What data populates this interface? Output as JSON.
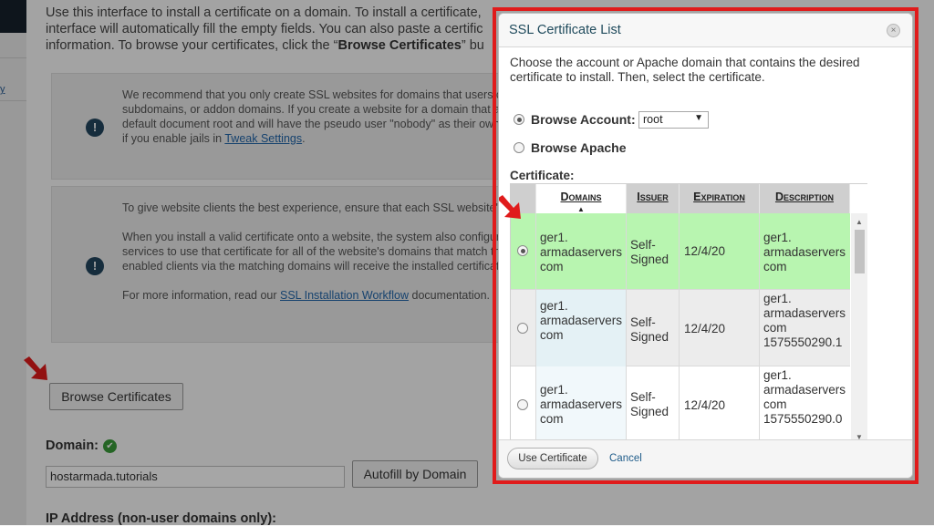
{
  "page": {
    "intro_lines": [
      "Use this interface to install a certificate on a domain. To install a certificate,",
      "interface will automatically fill the empty fields. You can also paste a certific",
      "information. To browse your certificates, click the “"
    ],
    "intro_bold": "Browse Certificates",
    "intro_tail": "” bu",
    "note1": {
      "lines": [
        "We recommend that you only create SSL websites for domains that users c",
        "subdomains, or addon domains. If you create a website for a domain that a",
        "default document root and will have the pseudo user \"nobody\" as their owne",
        "if you enable jails in "
      ],
      "link": "Tweak Settings",
      "link_tail": "."
    },
    "note2": {
      "p1": "To give website clients the best experience, ensure that each SSL website's",
      "p2_lines": [
        "When you install a valid certificate onto a website, the system also configur",
        "services to use that certificate for all of the website's domains that match th",
        "enabled clients via the matching domains will receive the installed certificat"
      ],
      "p3_pre": "For more information, read our ",
      "p3_link": "SSL Installation Workflow",
      "p3_post": " documentation."
    },
    "browse_button": "Browse Certificates",
    "domain_label": "Domain:",
    "domain_value": "hostarmada.tutorials",
    "autofill_button": "Autofill by Domain",
    "ip_label": "IP Address (non-user domains only):",
    "sidebar_fragment": "y",
    "info_icon_glyph": "!",
    "check_icon_glyph": "✔"
  },
  "modal": {
    "title": "SSL Certificate List",
    "close_glyph": "×",
    "instructions": "Choose the account or Apache domain that contains the desired certificate to install. Then, select the certificate.",
    "browse_account_label": "Browse Account:",
    "account_selected": "root",
    "select_caret": "▼",
    "browse_apache_label": "Browse Apache",
    "certificate_label": "Certificate:",
    "columns": [
      "Domains",
      "Issuer",
      "Expiration",
      "Description"
    ],
    "sort_glyph": "▲",
    "rows": [
      {
        "domain": [
          "ger1.",
          "armadaservers",
          "com"
        ],
        "issuer": [
          "Self-",
          "Signed"
        ],
        "expiration": "12/4/20",
        "description": [
          "ger1.",
          "armadaservers",
          "com"
        ],
        "selected": true
      },
      {
        "domain": [
          "ger1.",
          "armadaservers",
          "com"
        ],
        "issuer": [
          "Self-",
          "Signed"
        ],
        "expiration": "12/4/20",
        "description": [
          "ger1.",
          "armadaservers",
          "com",
          "1575550290.1"
        ],
        "selected": false
      },
      {
        "domain": [
          "ger1.",
          "armadaservers",
          "com"
        ],
        "issuer": [
          "Self-",
          "Signed"
        ],
        "expiration": "12/4/20",
        "description": [
          "ger1.",
          "armadaservers",
          "com",
          "1575550290.0"
        ],
        "selected": false
      }
    ],
    "scroll_up_glyph": "▲",
    "scroll_down_glyph": "▼",
    "use_button": "Use Certificate",
    "cancel_link": "Cancel"
  },
  "colors": {
    "selected_row": "#b8f5b0",
    "row_alt": "#e9f4f7",
    "row_alt2": "#f3f9fb",
    "highlight_frame": "#e01b1b",
    "arrow": "#e01b1b"
  }
}
